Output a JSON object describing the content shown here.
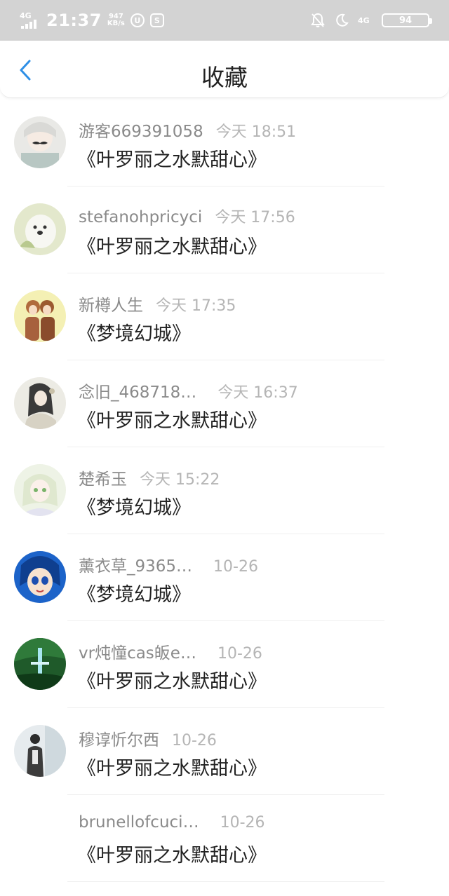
{
  "status_bar": {
    "network": "4G",
    "time": "21:37",
    "speed_value": "947",
    "speed_unit": "KB/s",
    "icon_circle_text": "U",
    "icon_square_text": "S",
    "network_right": "4G",
    "battery": "94"
  },
  "header": {
    "title": "收藏"
  },
  "items": [
    {
      "user": "游客669391058",
      "time": "今天 18:51",
      "book": "《叶罗丽之水默甜心》"
    },
    {
      "user": "stefanohpricyci",
      "time": "今天 17:56",
      "book": "《叶罗丽之水默甜心》"
    },
    {
      "user": "新樽人生",
      "time": "今天 17:35",
      "book": "《梦境幻城》"
    },
    {
      "user": "念旧_468718…",
      "time": "今天 16:37",
      "book": "《叶罗丽之水默甜心》"
    },
    {
      "user": "楚希玉",
      "time": "今天 15:22",
      "book": "《梦境幻城》"
    },
    {
      "user": "薰衣草_9365…",
      "time": "10-26",
      "book": "《梦境幻城》"
    },
    {
      "user": "vr炖憧cas皈e…",
      "time": "10-26",
      "book": "《叶罗丽之水默甜心》"
    },
    {
      "user": "穆谆忻尔西",
      "time": "10-26",
      "book": "《叶罗丽之水默甜心》"
    },
    {
      "user": "brunellofcuci…",
      "time": "10-26",
      "book": "《叶罗丽之水默甜心》"
    }
  ],
  "colors": {
    "status_bar_bg": "#d3d3d3",
    "accent_back": "#2e8fe6",
    "text_primary": "#222222",
    "text_secondary": "#8a8a8a",
    "text_time": "#b5b5b5"
  }
}
